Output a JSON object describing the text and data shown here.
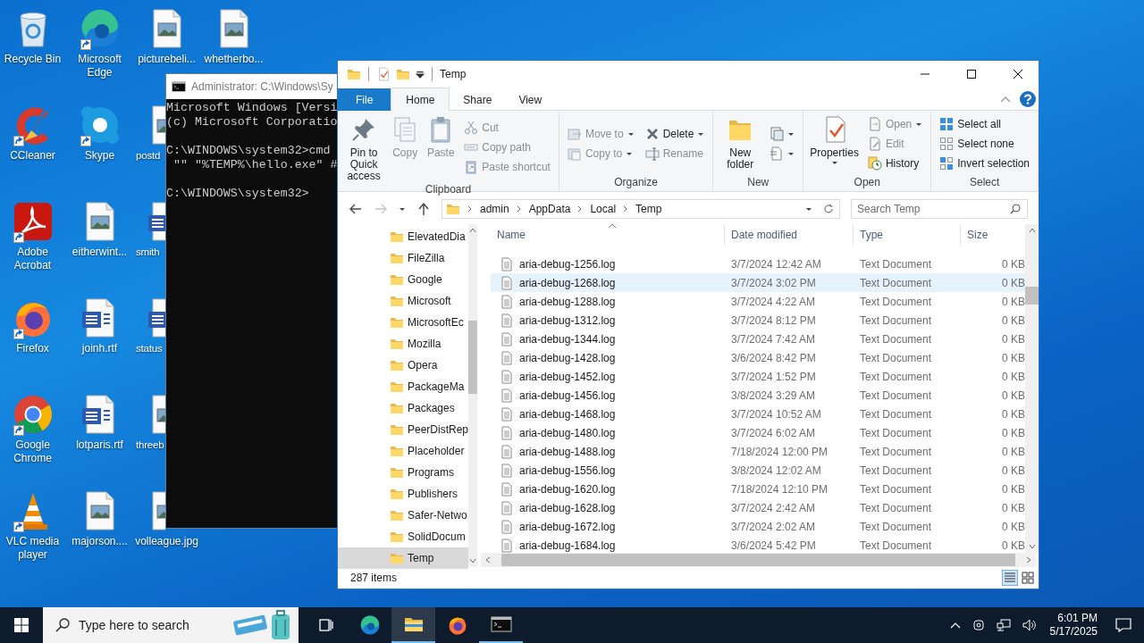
{
  "desktop": {
    "columns": [
      {
        "items": [
          {
            "label": "Recycle Bin",
            "kind": "recycle",
            "shortcut": false,
            "clipped": false
          },
          {
            "label": "CCleaner",
            "kind": "ccleaner",
            "shortcut": true,
            "clipped": false
          },
          {
            "label": "Adobe Acrobat",
            "kind": "acrobat",
            "shortcut": true,
            "clipped": false
          },
          {
            "label": "Firefox",
            "kind": "firefox",
            "shortcut": true,
            "clipped": false
          },
          {
            "label": "Google Chrome",
            "kind": "chrome",
            "shortcut": true,
            "clipped": false
          },
          {
            "label": "VLC media player",
            "kind": "vlc",
            "shortcut": true,
            "clipped": false
          }
        ]
      },
      {
        "items": [
          {
            "label": "Microsoft Edge",
            "kind": "edge",
            "shortcut": true,
            "clipped": false
          },
          {
            "label": "Skype",
            "kind": "skype",
            "shortcut": true,
            "clipped": false
          },
          {
            "label": "eitherwint...",
            "kind": "image",
            "shortcut": false,
            "clipped": false
          },
          {
            "label": "joinh.rtf",
            "kind": "word",
            "shortcut": false,
            "clipped": false
          },
          {
            "label": "lotparis.rtf",
            "kind": "word",
            "shortcut": false,
            "clipped": false
          },
          {
            "label": "majorson....",
            "kind": "image",
            "shortcut": false,
            "clipped": false
          }
        ]
      },
      {
        "items": [
          {
            "label": "picturebeli...",
            "kind": "image",
            "shortcut": false,
            "clipped": false
          },
          {
            "label": "postd",
            "kind": "image",
            "shortcut": false,
            "clipped": true
          },
          {
            "label": "smith",
            "kind": "word",
            "shortcut": false,
            "clipped": true
          },
          {
            "label": "status",
            "kind": "word",
            "shortcut": false,
            "clipped": true
          },
          {
            "label": "threeb",
            "kind": "image",
            "shortcut": false,
            "clipped": true
          },
          {
            "label": "volleague.jpg",
            "kind": "image",
            "shortcut": false,
            "clipped": false
          }
        ]
      },
      {
        "items": [
          {
            "label": "whetherbo...",
            "kind": "image",
            "shortcut": false,
            "clipped": false
          }
        ]
      }
    ]
  },
  "cmd_window": {
    "title": "Administrator: C:\\Windows\\Sy",
    "blocks": [
      [
        "Microsoft Windows [Versi",
        "(c) Microsoft Corporatio"
      ],
      [
        "C:\\WINDOWS\\system32>cmd",
        " \"\" \"%TEMP%\\hello.exe\" #"
      ],
      [
        "C:\\WINDOWS\\system32>"
      ]
    ]
  },
  "explorer": {
    "title": "Temp",
    "tabs": [
      {
        "label": "File",
        "kind": "file",
        "selected": false
      },
      {
        "label": "Home",
        "kind": "tab",
        "selected": true
      },
      {
        "label": "Share",
        "kind": "tab",
        "selected": false
      },
      {
        "label": "View",
        "kind": "tab",
        "selected": false
      }
    ],
    "ribbon": [
      {
        "label": "Clipboard",
        "large": [
          {
            "label": "Pin to Quick access",
            "kind": "pin",
            "disabled": false,
            "dropdown": false
          },
          {
            "label": "Copy",
            "kind": "copy",
            "disabled": true,
            "dropdown": false
          },
          {
            "label": "Paste",
            "kind": "paste",
            "disabled": true,
            "dropdown": false
          }
        ],
        "stacks": [
          [
            {
              "label": "Cut",
              "kind": "cut",
              "disabled": true,
              "dropdown": false
            },
            {
              "label": "Copy path",
              "kind": "copypath",
              "disabled": true,
              "dropdown": false
            },
            {
              "label": "Paste shortcut",
              "kind": "pasteshortcut",
              "disabled": true,
              "dropdown": false
            }
          ]
        ]
      },
      {
        "label": "Organize",
        "stacks": [
          [
            {
              "label": "Move to",
              "kind": "move",
              "disabled": true,
              "dropdown": true
            },
            {
              "label": "Copy to",
              "kind": "copyto",
              "disabled": true,
              "dropdown": true
            }
          ],
          [
            {
              "label": "Delete",
              "kind": "delete",
              "disabled": false,
              "dropdown": true
            },
            {
              "label": "Rename",
              "kind": "rename",
              "disabled": true,
              "dropdown": false
            }
          ]
        ]
      },
      {
        "label": "New",
        "large": [
          {
            "label": "New folder",
            "kind": "newfolder",
            "disabled": false,
            "dropdown": false
          }
        ],
        "stacks": [
          [
            {
              "kind": "newitem",
              "dropdown": true
            },
            {
              "kind": "easyaccess",
              "dropdown": true
            }
          ]
        ]
      },
      {
        "label": "Open",
        "large": [
          {
            "label": "Properties",
            "kind": "properties",
            "disabled": false,
            "dropdown": true
          }
        ],
        "stacks": [
          [
            {
              "label": "Open",
              "kind": "open",
              "disabled": true,
              "dropdown": true
            },
            {
              "label": "Edit",
              "kind": "edit",
              "disabled": true,
              "dropdown": false
            },
            {
              "label": "History",
              "kind": "history",
              "disabled": false,
              "dropdown": false
            }
          ]
        ]
      },
      {
        "label": "Select",
        "stacks": [
          [
            {
              "label": "Select all",
              "kind": "selectall",
              "disabled": false,
              "dropdown": false
            },
            {
              "label": "Select none",
              "kind": "selectnone",
              "disabled": false,
              "dropdown": false
            },
            {
              "label": "Invert selection",
              "kind": "invert",
              "disabled": false,
              "dropdown": false
            }
          ]
        ]
      }
    ],
    "path": [
      "admin",
      "AppData",
      "Local",
      "Temp"
    ],
    "search": {
      "placeholder": "Search Temp"
    },
    "nav_items": [
      {
        "label": "ElevatedDia",
        "selected": false
      },
      {
        "label": "FileZilla",
        "selected": false
      },
      {
        "label": "Google",
        "selected": false
      },
      {
        "label": "Microsoft",
        "selected": false
      },
      {
        "label": "MicrosoftEc",
        "selected": false
      },
      {
        "label": "Mozilla",
        "selected": false
      },
      {
        "label": "Opera",
        "selected": false
      },
      {
        "label": "PackageMa",
        "selected": false
      },
      {
        "label": "Packages",
        "selected": false
      },
      {
        "label": "PeerDistRep",
        "selected": false
      },
      {
        "label": "Placeholder",
        "selected": false
      },
      {
        "label": "Programs",
        "selected": false
      },
      {
        "label": "Publishers",
        "selected": false
      },
      {
        "label": "Safer-Netwo",
        "selected": false
      },
      {
        "label": "SolidDocum",
        "selected": false
      },
      {
        "label": "Temp",
        "selected": true
      }
    ],
    "columns": [
      {
        "label": "Name",
        "sorted": true
      },
      {
        "label": "Date modified",
        "sorted": false
      },
      {
        "label": "Type",
        "sorted": false
      },
      {
        "label": "Size",
        "sorted": false
      }
    ],
    "rows": [
      {
        "name": "aria-debug-1256.log",
        "date": "3/7/2024 12:42 AM",
        "type": "Text Document",
        "size": "0 KB",
        "selected": false
      },
      {
        "name": "aria-debug-1268.log",
        "date": "3/7/2024 3:02 PM",
        "type": "Text Document",
        "size": "0 KB",
        "selected": true
      },
      {
        "name": "aria-debug-1288.log",
        "date": "3/7/2024 4:22 AM",
        "type": "Text Document",
        "size": "0 KB",
        "selected": false
      },
      {
        "name": "aria-debug-1312.log",
        "date": "3/7/2024 8:12 PM",
        "type": "Text Document",
        "size": "0 KB",
        "selected": false
      },
      {
        "name": "aria-debug-1344.log",
        "date": "3/7/2024 7:42 AM",
        "type": "Text Document",
        "size": "0 KB",
        "selected": false
      },
      {
        "name": "aria-debug-1428.log",
        "date": "3/6/2024 8:42 PM",
        "type": "Text Document",
        "size": "0 KB",
        "selected": false
      },
      {
        "name": "aria-debug-1452.log",
        "date": "3/7/2024 1:52 PM",
        "type": "Text Document",
        "size": "0 KB",
        "selected": false
      },
      {
        "name": "aria-debug-1456.log",
        "date": "3/8/2024 3:29 AM",
        "type": "Text Document",
        "size": "0 KB",
        "selected": false
      },
      {
        "name": "aria-debug-1468.log",
        "date": "3/7/2024 10:52 AM",
        "type": "Text Document",
        "size": "0 KB",
        "selected": false
      },
      {
        "name": "aria-debug-1480.log",
        "date": "3/7/2024 6:02 AM",
        "type": "Text Document",
        "size": "0 KB",
        "selected": false
      },
      {
        "name": "aria-debug-1488.log",
        "date": "7/18/2024 12:00 PM",
        "type": "Text Document",
        "size": "0 KB",
        "selected": false
      },
      {
        "name": "aria-debug-1556.log",
        "date": "3/8/2024 12:02 AM",
        "type": "Text Document",
        "size": "0 KB",
        "selected": false
      },
      {
        "name": "aria-debug-1620.log",
        "date": "7/18/2024 12:10 PM",
        "type": "Text Document",
        "size": "0 KB",
        "selected": false
      },
      {
        "name": "aria-debug-1628.log",
        "date": "3/7/2024 2:42 AM",
        "type": "Text Document",
        "size": "0 KB",
        "selected": false
      },
      {
        "name": "aria-debug-1672.log",
        "date": "3/7/2024 2:02 AM",
        "type": "Text Document",
        "size": "0 KB",
        "selected": false
      },
      {
        "name": "aria-debug-1684.log",
        "date": "3/6/2024 5:42 PM",
        "type": "Text Document",
        "size": "0 KB",
        "selected": false
      }
    ],
    "status": "287 items"
  },
  "taskbar": {
    "search": {
      "placeholder": "Type here to search"
    },
    "apps": [
      {
        "kind": "taskview",
        "active": false,
        "running": false
      },
      {
        "kind": "edge",
        "active": false,
        "running": false
      },
      {
        "kind": "explorer",
        "active": true,
        "running": true
      },
      {
        "kind": "firefox",
        "active": false,
        "running": false
      },
      {
        "kind": "cmd",
        "active": false,
        "running": true
      }
    ],
    "time": "6:01 PM",
    "date": "5/17/2025"
  }
}
